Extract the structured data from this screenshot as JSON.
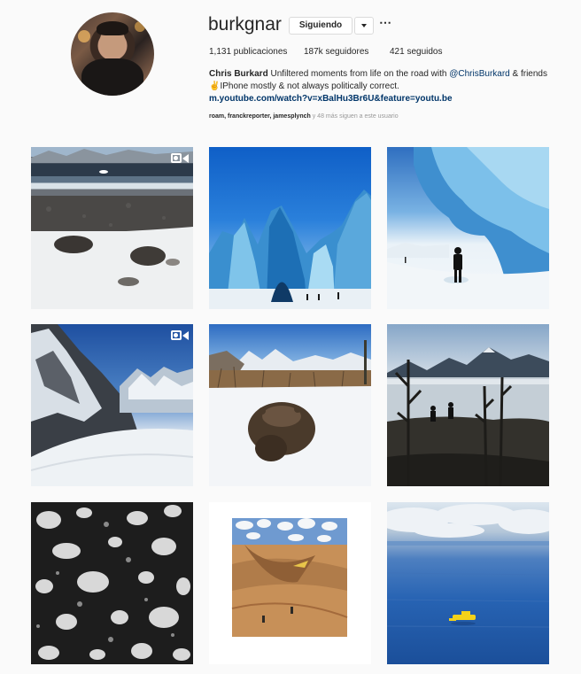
{
  "profile": {
    "username": "burkgnar",
    "follow_label": "Siguiendo",
    "stats": {
      "posts": "1,131 publicaciones",
      "followers": "187k seguidores",
      "following": "421 seguidos"
    },
    "bio": {
      "name": "Chris Burkard",
      "text1": "Unfiltered moments from life on the road with",
      "mention": "@ChrisBurkard",
      "text2": "& friends",
      "line2": "✌️IPhone mostly & not always politically correct.",
      "link": "m.youtube.com/watch?v=xBalHu3Br6U&feature=youtu.be"
    },
    "followed_by": {
      "names": "roam, franckreporter, jamesplynch",
      "rest": "y 48 más siguen a este usuario"
    }
  },
  "posts": [
    {
      "name": "post-beach-surf",
      "video": true
    },
    {
      "name": "post-ice-cave-peaks",
      "video": false
    },
    {
      "name": "post-ice-cave-hiker",
      "video": false
    },
    {
      "name": "post-mountain-glacier",
      "video": true
    },
    {
      "name": "post-bear-snow",
      "video": false
    },
    {
      "name": "post-lake-dead-trees",
      "video": false
    },
    {
      "name": "post-sea-ice-aerial",
      "video": false
    },
    {
      "name": "post-desert-illustration",
      "video": false
    },
    {
      "name": "post-ocean-plane",
      "video": false
    }
  ],
  "icons": {
    "video": "video-camera-icon",
    "dropdown": "chevron-down-icon",
    "more": "ellipsis-icon"
  }
}
